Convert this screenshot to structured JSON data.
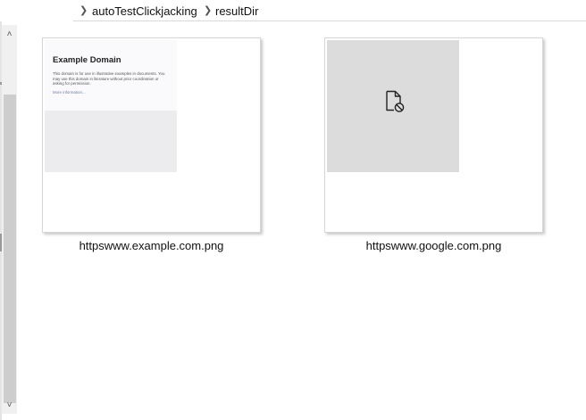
{
  "breadcrumb": {
    "items": [
      {
        "label": "autoTestClickjacking"
      },
      {
        "label": "resultDir"
      }
    ]
  },
  "files": [
    {
      "name": "httpswww.example.com.png",
      "preview": {
        "title": "Example Domain",
        "body": "This domain is for use in illustrative examples in documents. You may use this domain in literature without prior coordination or asking for permission.",
        "link": "More information..."
      }
    },
    {
      "name": "httpswww.google.com.png",
      "preview_icon": "broken-image-icon"
    }
  ],
  "icons": {
    "breadcrumb_separator": "chevron-right-icon",
    "scroll_up": "scroll-up-arrow-icon",
    "scroll_down": "scroll-down-arrow-icon"
  },
  "colors": {
    "tile_border": "#d6d6d6",
    "scrollbar_track": "#f0f0f0",
    "scrollbar_thumb": "#cdcdcd",
    "broken_thumb_bg": "#dcdcdc"
  }
}
